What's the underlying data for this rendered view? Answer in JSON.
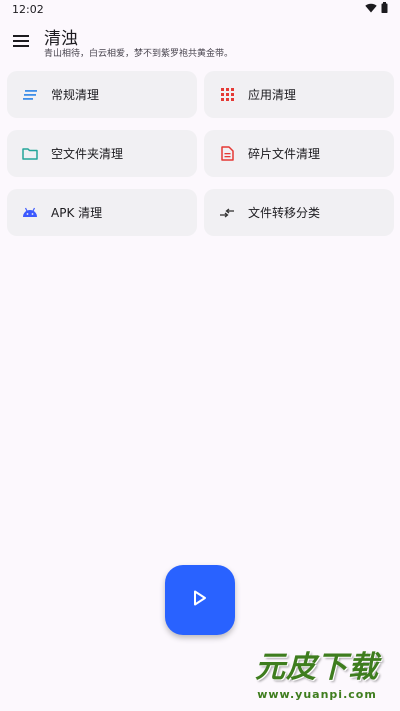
{
  "status_bar": {
    "time": "12:02",
    "icons": [
      "wifi-icon",
      "battery-icon"
    ]
  },
  "app_bar": {
    "menu_icon": "menu-icon",
    "title": "清浊",
    "subtitle": "青山相待，白云相爱，梦不到紫罗袍共黄金带。"
  },
  "cards": [
    {
      "label": "常规清理",
      "icon": "notes-lines-icon",
      "icon_color": "#3F8FE8"
    },
    {
      "label": "应用清理",
      "icon": "apps-grid-icon",
      "icon_color": "#E53935"
    },
    {
      "label": "空文件夹清理",
      "icon": "folder-icon",
      "icon_color": "#26A69A"
    },
    {
      "label": "碎片文件清理",
      "icon": "document-icon",
      "icon_color": "#E53935"
    },
    {
      "label": "APK 清理",
      "icon": "android-icon",
      "icon_color": "#3D5AFE"
    },
    {
      "label": "文件转移分类",
      "icon": "transfer-arrows-icon",
      "icon_color": "#333333"
    }
  ],
  "fab": {
    "icon": "play-icon",
    "color": "#2962FF"
  },
  "watermark": {
    "title": "元皮下载",
    "url": "www.yuanpi.com"
  }
}
